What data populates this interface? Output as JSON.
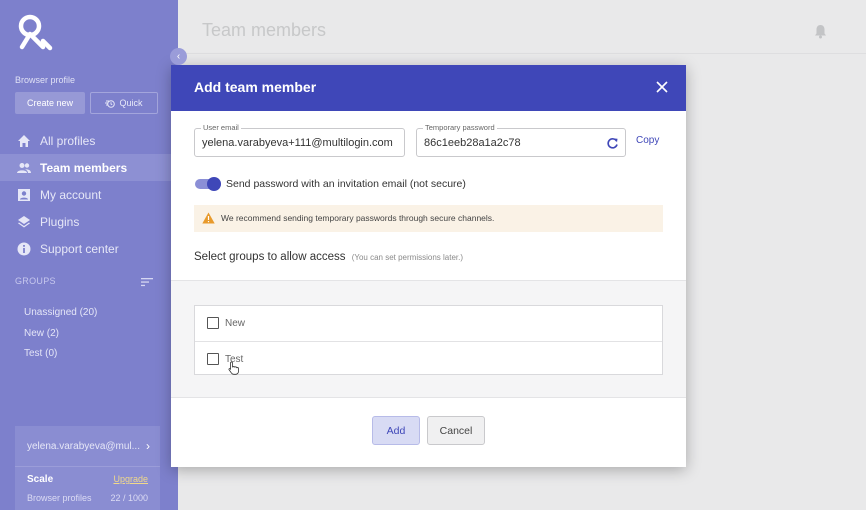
{
  "sidebar": {
    "browser_profile_label": "Browser profile",
    "create_new_label": "Create new",
    "quick_label": "Quick",
    "nav_items": [
      {
        "label": "All profiles",
        "icon": "home-icon"
      },
      {
        "label": "Team members",
        "icon": "team-icon"
      },
      {
        "label": "My account",
        "icon": "account-icon"
      },
      {
        "label": "Plugins",
        "icon": "layers-icon"
      },
      {
        "label": "Support center",
        "icon": "info-icon"
      }
    ],
    "active_nav": "Team members",
    "groups_header": "GROUPS",
    "groups": [
      {
        "label": "Unassigned (20)"
      },
      {
        "label": "New (2)"
      },
      {
        "label": "Test (0)"
      }
    ],
    "account_email": "yelena.varabyeva@mul...",
    "plan_name": "Scale",
    "upgrade_label": "Upgrade",
    "browser_profiles_label": "Browser profiles",
    "browser_profiles_count": "22 / 1000"
  },
  "header": {
    "title": "Team members"
  },
  "modal": {
    "title": "Add team member",
    "user_email_label": "User email",
    "user_email_value": "yelena.varabyeva+111@multilogin.com",
    "temp_password_label": "Temporary password",
    "temp_password_value": "86c1eeb28a1a2c78",
    "copy_label": "Copy",
    "send_invitation_label": "Send password with an invitation email (not secure)",
    "send_invitation_enabled": true,
    "warning_text": "We recommend sending temporary passwords through secure channels.",
    "groups_title": "Select groups to allow access",
    "groups_hint": "(You can set permissions later.)",
    "group_options": [
      {
        "label": "New",
        "checked": false
      },
      {
        "label": "Test",
        "checked": false
      }
    ],
    "add_label": "Add",
    "cancel_label": "Cancel"
  },
  "colors": {
    "sidebar_bg": "#7d80cc",
    "accent": "#3f47b8",
    "warning_bg": "#faf2e6",
    "warning_icon": "#e89a2c"
  }
}
